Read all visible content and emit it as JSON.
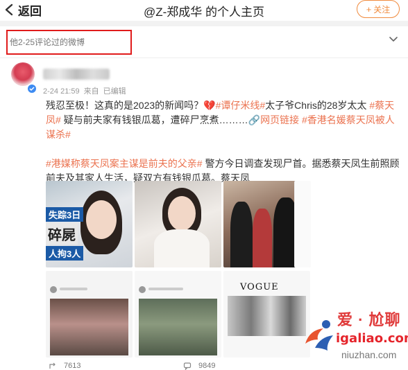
{
  "header": {
    "back_label": "返回",
    "title": "@Z-郑成华 的个人主页",
    "follow_label": "关注"
  },
  "filter": {
    "label": "他2-25评论过的微博"
  },
  "post": {
    "meta_time": "2-24 21:59",
    "meta_source": "来自",
    "meta_edited": "已编辑",
    "line1_a": "残忍至极！这真的是2023的新闻吗？",
    "tag1": "#谭仔米线#",
    "line1_b": "太子爷Chris的28岁太太",
    "tag2": "#蔡天凤#",
    "line2_a": "疑与前夫家有钱银瓜葛，遭碎尸烹煮………",
    "link_label": "网页链接",
    "tag3": "#香港名媛蔡天凤被人谋杀#",
    "tag4": "#港媒称蔡天凤案主谋是前夫的父亲#",
    "para2_a": "警方今日调查发现尸首。据悉蔡天凤生前照顾前夫及其家人生活，疑双方有钱银瓜葛。蔡天凤"
  },
  "images": {
    "overlay_line1": "失踪3日",
    "overlay_line2": "碎屍",
    "overlay_line3": "人拘3人",
    "vogue_text": "VOGUE"
  },
  "actions": {
    "repost_count": "7613",
    "comment_count": "9849"
  },
  "watermark": {
    "line1": "爱 · 尬聊",
    "line2": "igaliao.com",
    "line3": "niuzhan.com"
  },
  "colors": {
    "accent": "#eb7350",
    "follow": "#f08a3c",
    "highlight_box": "#e01b1b",
    "verified": "#3d8bf2"
  },
  "icons": {
    "back": "chevron-left-icon",
    "chevron": "chevron-down-icon",
    "link": "link-icon",
    "heart": "broken-heart-icon",
    "repost": "repost-icon",
    "comment": "comment-icon"
  }
}
